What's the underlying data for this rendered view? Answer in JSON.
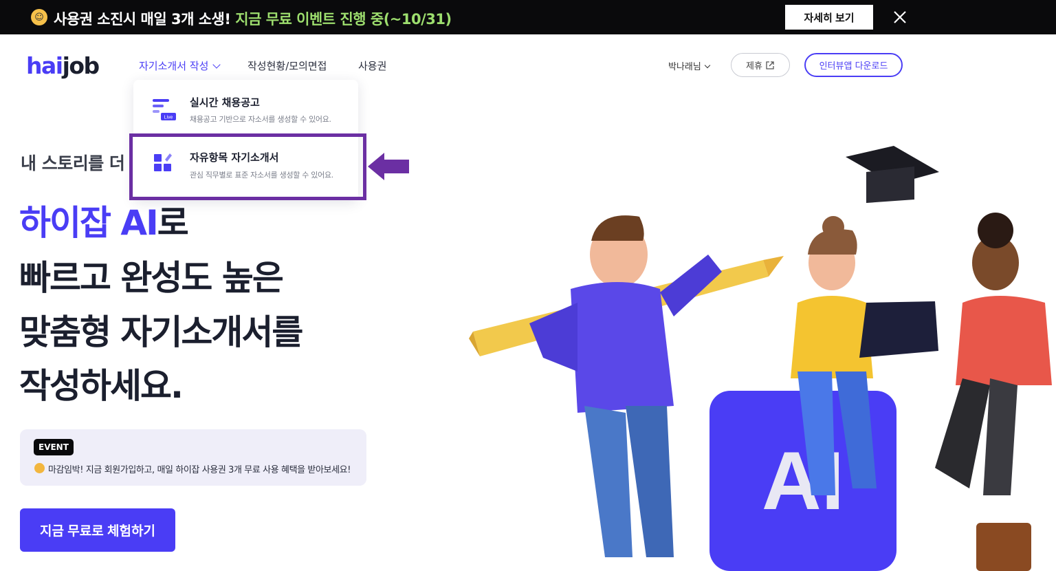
{
  "banner": {
    "message_main": "사용권 소진시 매일 3개 소생!",
    "message_highlight": "지금 무료 이벤트 진행 중(~10/31)",
    "detail_button": "자세히 보기",
    "emoji_icon": "party-face-icon",
    "close_icon": "close-icon"
  },
  "header": {
    "logo_a": "hai",
    "logo_b": "job",
    "nav": [
      {
        "label": "자기소개서 작성"
      },
      {
        "label": "작성현황/모의면접"
      },
      {
        "label": "사용권"
      }
    ],
    "user_label": "박나래님",
    "partner_label": "제휴",
    "download_label": "인터뷰앱 다운로드"
  },
  "dropdown": {
    "items": [
      {
        "title": "실시간 채용공고",
        "desc": "채용공고 기반으로 자소서를 생성할 수 있어요.",
        "badge": "Live"
      },
      {
        "title": "자유항목 자기소개서",
        "desc": "관심 직무별로 표준 자소서를 생성할 수 있어요."
      }
    ]
  },
  "hero": {
    "subtitle": "내 스토리를 더",
    "line1_accent": "하이잡 AI",
    "line1_rest": "로",
    "line2": "빠르고 완성도 높은",
    "line3": "맞춤형 자기소개서를",
    "line4": "작성하세요."
  },
  "event": {
    "badge": "EVENT",
    "text": "마감임박! 지금 회원가입하고, 매일 하이잡 사용권 3개 무료 사용 혜택을 받아보세요!"
  },
  "cta_label": "지금 무료로 체험하기",
  "illustration": {
    "block_label": "AI"
  },
  "colors": {
    "brand": "#4a3df5",
    "banner_bg": "#0a0a0c",
    "banner_highlight": "#9dde6e",
    "annotation": "#6b2fa3"
  }
}
